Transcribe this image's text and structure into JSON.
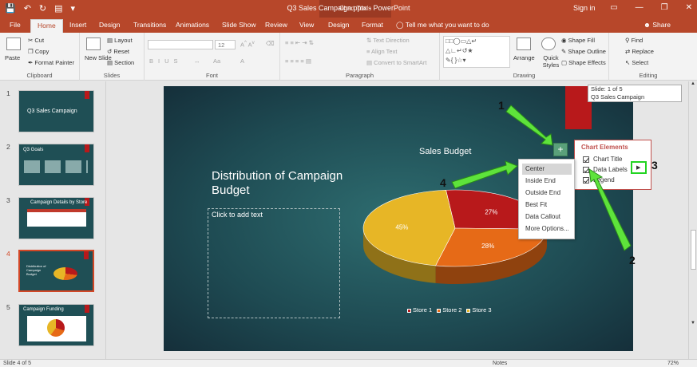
{
  "window": {
    "title": "Q3 Sales Campaign.pptx  -  PowerPoint",
    "context_tab_group": "Chart Tools",
    "sign_in": "Sign in"
  },
  "tabs": [
    "File",
    "Home",
    "Insert",
    "Design",
    "Transitions",
    "Animations",
    "Slide Show",
    "Review",
    "View",
    "Design",
    "Format"
  ],
  "tell_me": "Tell me what you want to do",
  "share": "Share",
  "ribbon": {
    "clipboard": {
      "label": "Clipboard",
      "paste": "Paste",
      "cut": "Cut",
      "copy": "Copy",
      "format_painter": "Format Painter"
    },
    "slides": {
      "label": "Slides",
      "new_slide": "New Slide",
      "layout": "Layout",
      "reset": "Reset",
      "section": "Section"
    },
    "font": {
      "label": "Font",
      "size": "12"
    },
    "paragraph": {
      "label": "Paragraph",
      "text_direction": "Text Direction",
      "align_text": "Align Text",
      "convert_smartart": "Convert to SmartArt"
    },
    "drawing": {
      "label": "Drawing",
      "arrange": "Arrange",
      "quick_styles": "Quick Styles",
      "shape_fill": "Shape Fill",
      "shape_outline": "Shape Outline",
      "shape_effects": "Shape Effects"
    },
    "editing": {
      "label": "Editing",
      "find": "Find",
      "replace": "Replace",
      "select": "Select"
    }
  },
  "thumbnails": [
    {
      "num": "1",
      "title": "Q3 Sales Campaign"
    },
    {
      "num": "2",
      "title": "Q3 Goals"
    },
    {
      "num": "3",
      "title": "Campaign Details by Store"
    },
    {
      "num": "4",
      "title": "Distribution of Campaign Budget"
    },
    {
      "num": "5",
      "title": "Campaign Funding"
    }
  ],
  "slide": {
    "title": "Distribution of Campaign Budget",
    "placeholder": "Click to add text",
    "chart_title": "Sales Budget"
  },
  "chart_data": {
    "type": "pie",
    "title": "Sales Budget",
    "categories": [
      "Store 1",
      "Store 2",
      "Store 3"
    ],
    "values": [
      27,
      28,
      45
    ],
    "labels": [
      "27%",
      "28%",
      "45%"
    ],
    "colors": [
      "#b8191b",
      "#e66a17",
      "#e7b626"
    ],
    "legend_position": "bottom"
  },
  "tooltip_status": {
    "line1": "Slide: 1 of 5",
    "line2": "Q3 Sales Campaign"
  },
  "chart_elements": {
    "header": "Chart Elements",
    "items": [
      {
        "label": "Chart Title",
        "checked": true
      },
      {
        "label": "Data Labels",
        "checked": true
      },
      {
        "label": "Legend",
        "checked": true
      }
    ]
  },
  "data_label_menu": [
    "Center",
    "Inside End",
    "Outside End",
    "Best Fit",
    "Data Callout",
    "More Options..."
  ],
  "callouts": [
    "1",
    "2",
    "3",
    "4"
  ],
  "status_bar": {
    "slide_info": "Slide 4 of 5",
    "notes": "Notes",
    "zoom": "72%"
  }
}
